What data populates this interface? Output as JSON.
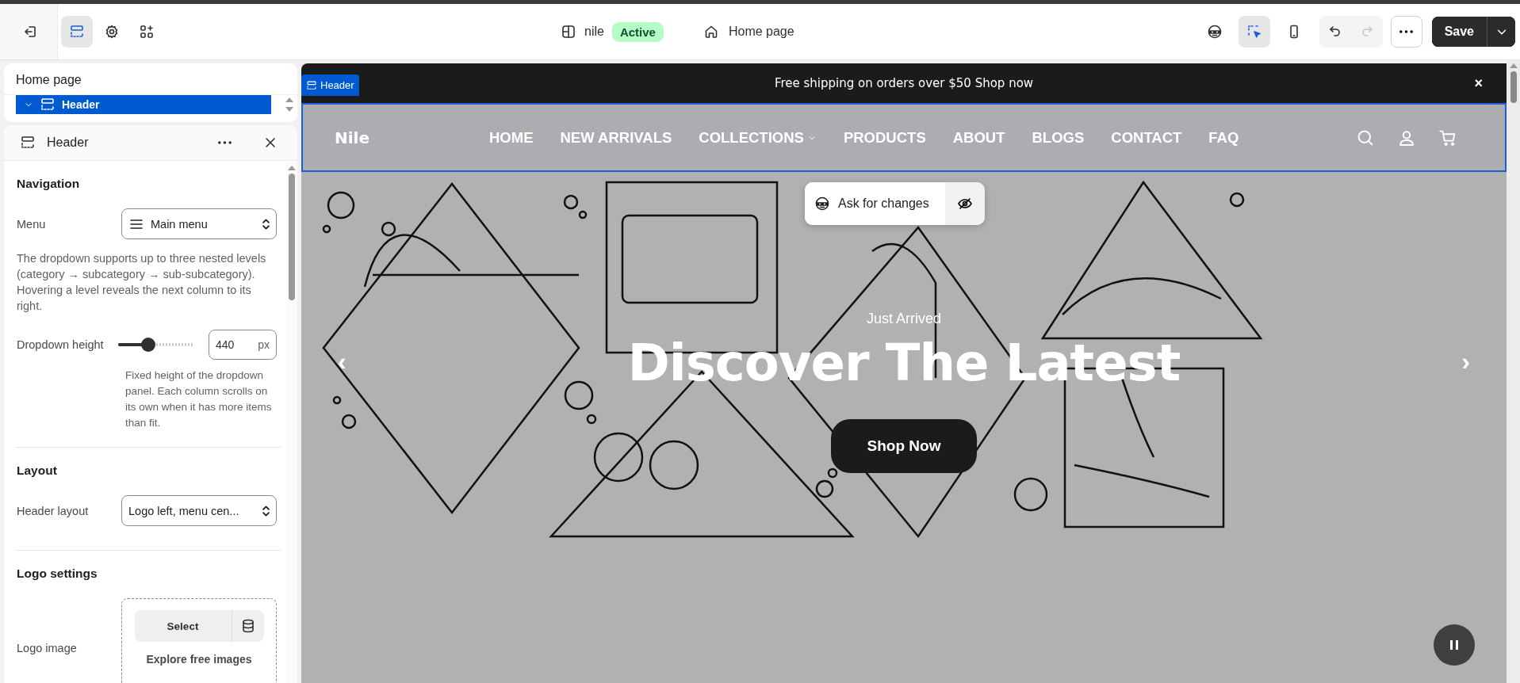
{
  "topbar": {
    "tools": [
      {
        "kind": "exit",
        "selected": false
      },
      {
        "kind": "sections",
        "selected": true
      },
      {
        "kind": "settings",
        "selected": false
      },
      {
        "kind": "apps",
        "selected": false
      }
    ],
    "store_name": "nile",
    "status_badge": "Active",
    "page_selector": "Home page",
    "view_tools": [
      {
        "kind": "ai",
        "selected": false
      },
      {
        "kind": "inspect",
        "selected": true
      },
      {
        "kind": "mobile",
        "selected": false
      }
    ],
    "undo_disabled": false,
    "redo_disabled": true,
    "save_button": "Save"
  },
  "sidebar": {
    "title": "Home page",
    "tree": [
      {
        "label": "Header",
        "expanded": true,
        "selected": true
      }
    ]
  },
  "settings_panel": {
    "title": "Header",
    "sections": [
      {
        "heading": "Navigation",
        "settings": [
          {
            "kind": "menu_select",
            "label": "Menu",
            "value": "Main menu"
          },
          {
            "kind": "help",
            "text": "The dropdown supports up to three nested levels (category → subcategory → sub-subcategory). Hovering a level reveals the next column to its right."
          },
          {
            "kind": "slider",
            "label": "Dropdown height",
            "level": 0.4,
            "value": "440",
            "unit": "px",
            "help": "Fixed height of the dropdown panel. Each column scrolls on its own when it has more items than fit."
          }
        ]
      },
      {
        "heading": "Layout",
        "settings": [
          {
            "kind": "select",
            "label": "Header layout",
            "value": "Logo left, menu cen..."
          }
        ]
      },
      {
        "heading": "Logo settings",
        "settings": [
          {
            "kind": "image_picker",
            "label": "Logo image",
            "button": "Select",
            "link": "Explore free images"
          }
        ]
      }
    ]
  },
  "preview": {
    "section_tag": "Header",
    "announcement": "Free shipping on orders over $50 Shop now",
    "announcement_close": "×",
    "logo": "Nile",
    "nav": [
      {
        "label": "HOME",
        "has_dropdown": false
      },
      {
        "label": "NEW ARRIVALS",
        "has_dropdown": false
      },
      {
        "label": "COLLECTIONS",
        "has_dropdown": true
      },
      {
        "label": "PRODUCTS",
        "has_dropdown": false
      },
      {
        "label": "ABOUT",
        "has_dropdown": false
      },
      {
        "label": "BLOGS",
        "has_dropdown": false
      },
      {
        "label": "CONTACT",
        "has_dropdown": false
      },
      {
        "label": "FAQ",
        "has_dropdown": false
      }
    ],
    "ask_popup": "Ask for changes",
    "hero": {
      "eyebrow": "Just Arrived",
      "heading": "Discover The Latest",
      "button": "Shop Now",
      "prev": "‹",
      "next": "›"
    }
  }
}
